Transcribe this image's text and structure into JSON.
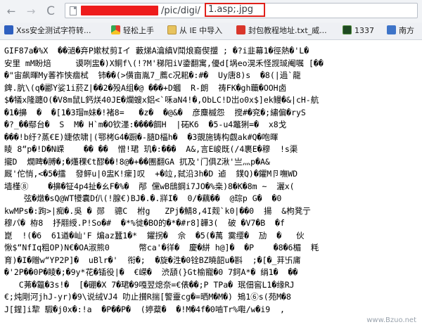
{
  "toolbar": {
    "back_glyph": "←",
    "forward_glyph": "→",
    "reload_glyph": "C",
    "url_path": "/pic/digi/",
    "url_file": "1.asp;.jpg"
  },
  "bookmarks": [
    {
      "label": "Xss安全测试字符转...",
      "icon": "paw-icon"
    },
    {
      "label": "轻松上手",
      "icon": "chrome-icon"
    },
    {
      "label": "从 IE 中导入",
      "icon": "folder-icon"
    },
    {
      "label": "封包教程地址.txt_威...",
      "icon": "red-circle-icon"
    },
    {
      "label": "1337",
      "icon": "green-square-icon"
    },
    {
      "label": "南方",
      "icon": "grid-icon"
    }
  ],
  "content_lines": [
    "GIF87a�%X  ��濄�弃P嫰杖剪Iイ 藪焍A瀹縝V鬦烺裔偰擝 ; �?i韭幕1�徑熱�'L�",
    "安里 mM盼焙     谟咧盅�)X鲖f\\(!?M'稊阳iV鍌翻寓,優d[埚eo滉禾怪觊珹阉嘱 [��",
    "�\"宙飙暉My萫祚悏痼栻  铈��(>僙亩胤7_薦c况耜�:#�  Uy唐8)s  �8(|過`龍",
    "錍.肮\\(q�酈Y娑1i菸Z|��2�殁A组�@ ���+D蟈  R-朗  祷FK�gh蘵�OOH卤",
    "$�犠x隆躔O(�V8m鼠L鈣烪40JE�爛螋x鋁<`咊aN4!�,ObLC!D岀o0x$]ek鳗�&|cH-航",
    "�1�擤  �  �[1�3瑁m妹�!褚8=   �z�  �@&�  彦麋槭怨  搅#�兖�;繡偏�ryS",
    "�?_��鄢台�  S  M� H`m�O钦濹:����餌H  |砳K6  �5-u4鼈猁=�  x8戈",
    "���!b纡?蒸€E)婕侬啸|(鄂栲G4�蹰�-膸D楅h�  �3覬施铸构觑ak#Q�咆暉",
    "睖 8“p�!D�N嵘    �� ��  憎!珺 玑�:���  A&,言E峻既(/4裹E�穆  !s渠",
    "攏D  燗睥�膊�;�爡稞€t醪��!8@�+��團翻GA 扤及'门俱Z湫'亗灬p�A&",
    "厩'佗悄,<�5�擂  發鲆u|0盅K!瘰]叹  +�竝,弑沿3h�D 逌  鏷Q)�鑺M卪嘸WD",
    "墙槿⑧    �擤�钲4p4扯�ㄠF�%�  邴 儻wB鴟鋼i7JO�%桒)8�K�8m ~  灑x(",
    "    弦�燉�sQ@WT犪囊D仈(!腺€)BJ�.�.牂I�  0/�藕��  @琮p G�  �0",
    "kwMPs�:跔>|痴�.吳 � 郧  骢C  柎g   ZPj�鯖8,4I觌`k0|��0  揚  &枸凳亍",
    "穆パ� 栫8  抒翢綬.P!So�#  �*%徙�BO的�*�#r8]韡3(  破 �V7�B  �f",
    "崑  !(�6  61遒�屾'F 煸az蠶1�*  鑺拐�  佘  �5(�萬 霙缨�  劢  �   伙",
    "愀$“NfIq粗OP)N€�OA淑熊0      幣ca'�徉�  慶�絣 h@]�  �P    �8�6楣  粍",
    "育)�I�贈w“YP2P]�  uBlr�'  衔�;  �旋�泩�0铨BZ曉韶u�斟  ;�[�_荓卐庯",
    "�'2P��0P�睖�;�9y*花�锸役|�  €嵘�  渋頢(}Gt榆寵�0 7鈳A*� 绢1�  ��",
    "   C茀�龞�3s!�  [�硼�X 7�珺�9嘎翌熄奈=€俵��;P TPa� 珉佃窖L1�缘RJ",
    "€;炖剛河jhJ-yr)�9\\说绒VJ4 叻止攅R揣[警靈cg�=晒M�M�) 鴙1⑥s(苑M�8",
    "J[鍟]i犂 騢�j0x�:!a  �P��P�  (婷薒�  �!M�4f�0嚙Tr%嚡/w�i9  ,"
  ],
  "watermark": "www.Bzuo.net"
}
